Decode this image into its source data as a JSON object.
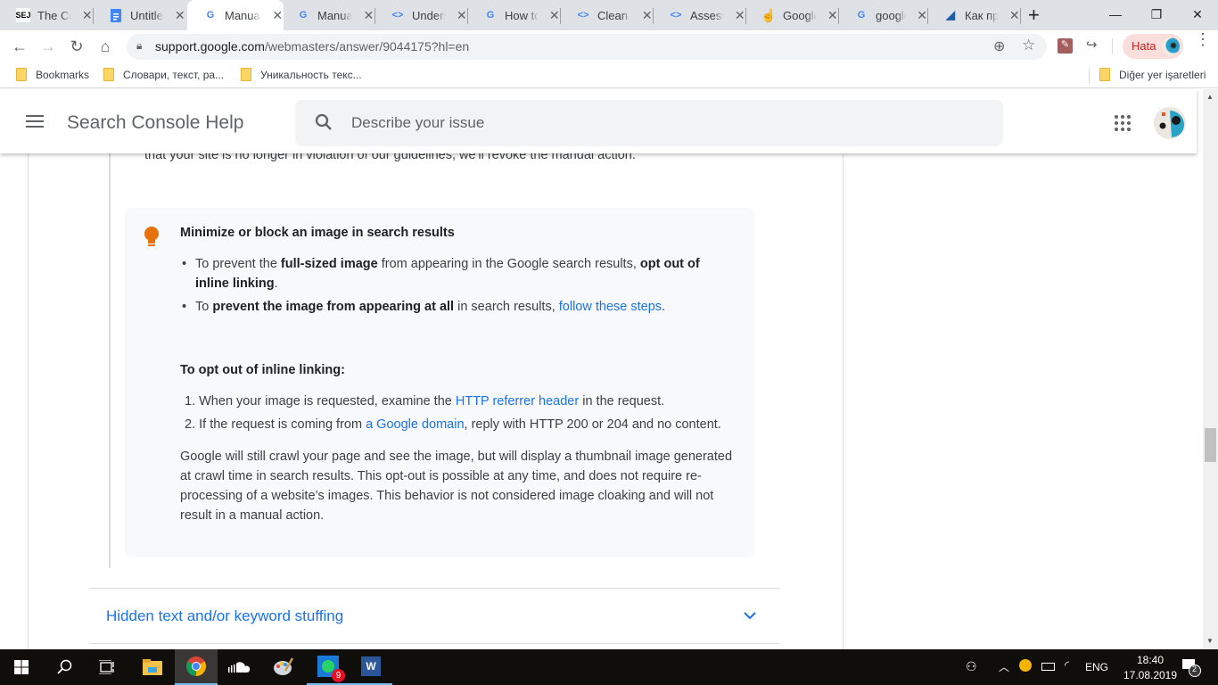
{
  "browser": {
    "tabs": [
      {
        "title": "The Complete",
        "favicon": "sej-icon",
        "active": false
      },
      {
        "title": "Untitled document",
        "favicon": "docs-icon",
        "active": false
      },
      {
        "title": "Manual Actions",
        "favicon": "google-icon",
        "active": true
      },
      {
        "title": "Manual Actions",
        "favicon": "google-icon",
        "active": false
      },
      {
        "title": "Understand",
        "favicon": "webmaster-icon",
        "active": false
      },
      {
        "title": "How to",
        "favicon": "google-icon",
        "active": false
      },
      {
        "title": "Clean and",
        "favicon": "webmaster-icon",
        "active": false
      },
      {
        "title": "Assess",
        "favicon": "webmaster-icon",
        "active": false
      },
      {
        "title": "Google",
        "favicon": "hand-icon",
        "active": false
      },
      {
        "title": "google",
        "favicon": "google-icon",
        "active": false
      },
      {
        "title": "Как продвигать",
        "favicon": "chart-icon",
        "active": false
      }
    ],
    "new_tab_symbol": "+",
    "window_controls": {
      "minimize": "—",
      "maximize": "❐",
      "close": "✕"
    },
    "url_host": "support.google.com",
    "url_path": "/webmasters/answer/9044175?hl=en",
    "profile_label": "Hata",
    "bookmarks": [
      "Bookmarks",
      "Словари, текст, ра...",
      "Уникальность текс..."
    ],
    "other_bookmarks": "Diğer yer işaretleri"
  },
  "header": {
    "title": "Search Console Help",
    "search_placeholder": "Describe your issue"
  },
  "content": {
    "cut_line": "that your site is no longer in violation of our guidelines, we'll revoke the manual action.",
    "tip": {
      "title": "Minimize or block an image in search results",
      "bullets": [
        {
          "p1": "To prevent the ",
          "b1": "full-sized image",
          "p2": " from appearing in the Google search results, ",
          "b2": "opt out of inline linking",
          "p3": "."
        },
        {
          "p1": "To ",
          "b1": "prevent the image from appearing at all",
          "p2": " in search results, ",
          "link": "follow these steps",
          "p3": "."
        }
      ],
      "subheading": "To opt out of inline linking:",
      "steps": [
        {
          "p1": "When your image is requested, examine the ",
          "link": "HTTP referrer header",
          "p2": " in the request."
        },
        {
          "p1": "If the request is coming from ",
          "link": "a Google domain",
          "p2": ", reply with HTTP 200 or 204 and no content."
        }
      ],
      "paragraph": "Google will still crawl your page and see the image, but will display a thumbnail image generated at crawl time in search results. This opt-out is possible at any time, and does not require re-processing of a website’s images. This behavior is not considered image cloaking and will not result in a manual action."
    },
    "accordion": {
      "label": "Hidden text and/or keyword stuffing"
    }
  },
  "taskbar": {
    "whatsapp_badge": "9",
    "language": "ENG",
    "time": "18:40",
    "date": "17.08.2019",
    "notification_count": "2"
  },
  "colors": {
    "link": "#1a73e8",
    "tip_icon": "#e8710a"
  }
}
